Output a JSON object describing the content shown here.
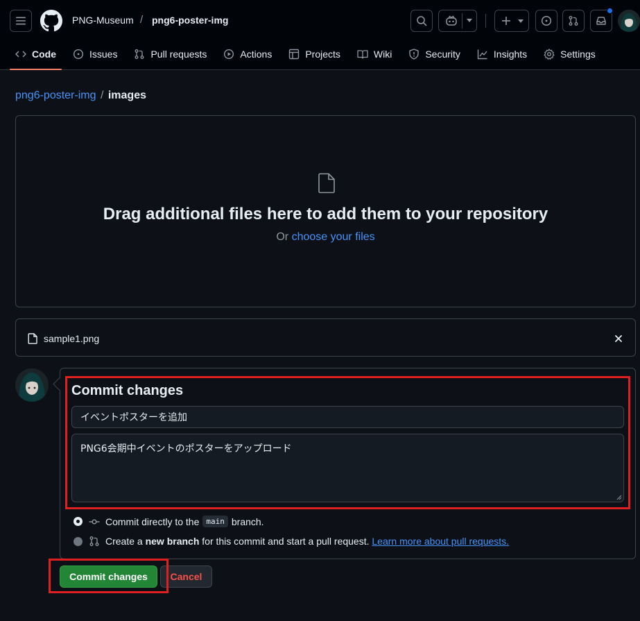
{
  "header": {
    "owner": "PNG-Museum",
    "separator": "/",
    "repo": "png6-poster-img"
  },
  "tabs": [
    {
      "label": "Code",
      "icon": "code-icon",
      "active": true
    },
    {
      "label": "Issues",
      "icon": "issue-icon"
    },
    {
      "label": "Pull requests",
      "icon": "pull-request-icon"
    },
    {
      "label": "Actions",
      "icon": "play-icon"
    },
    {
      "label": "Projects",
      "icon": "table-icon"
    },
    {
      "label": "Wiki",
      "icon": "book-icon"
    },
    {
      "label": "Security",
      "icon": "shield-icon"
    },
    {
      "label": "Insights",
      "icon": "graph-icon"
    },
    {
      "label": "Settings",
      "icon": "gear-icon"
    }
  ],
  "breadcrumb": {
    "repo": "png6-poster-img",
    "separator": "/",
    "folder": "images"
  },
  "dropzone": {
    "title": "Drag additional files here to add them to your repository",
    "or_text": "Or",
    "choose_link": "choose your files"
  },
  "files": [
    {
      "name": "sample1.png"
    }
  ],
  "commit": {
    "heading": "Commit changes",
    "summary_value": "イベントポスターを追加",
    "description_value": "PNG6会期中イベントのポスターをアップロード",
    "option_direct": {
      "prefix": "Commit directly to the",
      "branch": "main",
      "suffix": "branch."
    },
    "option_new_branch": {
      "prefix": "Create a",
      "bold": "new branch",
      "suffix": "for this commit and start a pull request.",
      "link": "Learn more about pull requests."
    },
    "commit_button": "Commit changes",
    "cancel_button": "Cancel"
  },
  "colors": {
    "accent_blue": "#4493f8",
    "commit_green": "#238636",
    "cancel_red": "#f85149",
    "highlight_red": "#e02020",
    "tab_underline": "#f78166"
  }
}
